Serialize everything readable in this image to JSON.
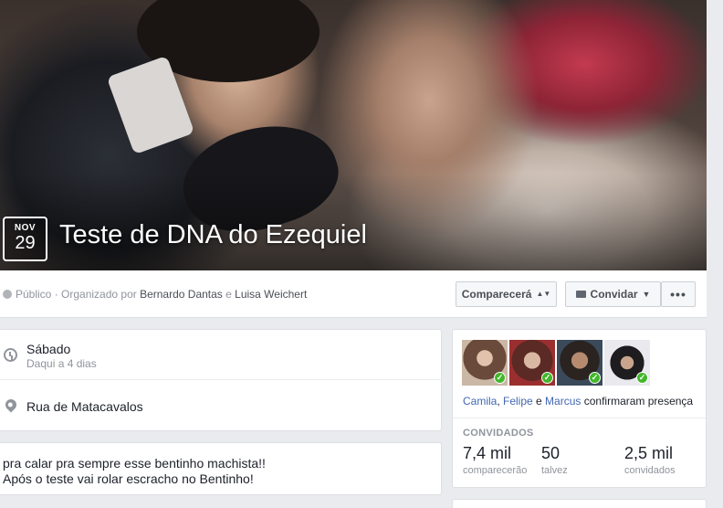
{
  "event": {
    "month": "NOV",
    "day": "29",
    "title": "Teste de DNA do Ezequiel"
  },
  "infobar": {
    "privacy": "Público",
    "organized_prefix": " · Organizado por ",
    "organizer1": "Bernardo Dantas",
    "and": " e ",
    "organizer2": "Luisa Weichert",
    "attend_label": "Comparecerá",
    "invite_label": "Convidar",
    "more_label": "•••"
  },
  "details": {
    "when_main": "Sábado",
    "when_sub": "Daqui a 4 dias",
    "where": "Rua de Matacavalos"
  },
  "description": {
    "line1": "pra calar pra sempre esse bentinho machista!!",
    "line2": "Após o teste vai rolar escracho no Bentinho!"
  },
  "guests": {
    "friend1": "Camila",
    "sep1": ", ",
    "friend2": "Felipe",
    "sep2": " e ",
    "friend3": "Marcus",
    "confirm_suffix": " confirmaram presença",
    "heading": "CONVIDADOS",
    "going_count": "7,4 mil",
    "going_label": "comparecerão",
    "maybe_count": "50",
    "maybe_label": "talvez",
    "invited_count": "2,5 mil",
    "invited_label": "convidados"
  },
  "colors": {
    "accent_link": "#4267b2",
    "check_green": "#42b72a",
    "background": "#e9ebee"
  }
}
